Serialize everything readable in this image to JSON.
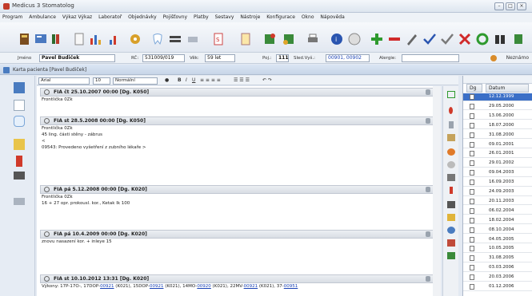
{
  "window": {
    "title": "Medicus 3 Stomatolog"
  },
  "menu": [
    "Program",
    "Ambulance",
    "Výkaz Výkaz",
    "Laboratoř",
    "Objednávky",
    "Pojišťovny",
    "Platby",
    "Sestavy",
    "Nástroje",
    "Konfigurace",
    "Okno",
    "Nápověda"
  ],
  "patient": {
    "name_label": "Jméno",
    "name": "Pavel Budiček",
    "rc_label": "RČ:",
    "rc": "531009/019",
    "age_label": "Věk:",
    "age": "59 let",
    "poj_label": "Poj.:",
    "poj": "111",
    "sled_label": "Sled.Vyš.:",
    "sled": "00901, 00902",
    "alergie_label": "Alergie:",
    "alergie": "",
    "unknown_label": "Neznámo"
  },
  "karta": {
    "title": "Karta pacienta [Pavel Budiček]"
  },
  "editor": {
    "font": "Arial",
    "size": "10",
    "style": "Normální"
  },
  "notes": [
    {
      "head": "FIA čt 25.10.2007 00:00 [Dg. K050]",
      "lines": [
        "Frontlička 0Zk"
      ]
    },
    {
      "head": "FIA st 28.5.2008 00:00 [Dg. K050]",
      "lines": [
        "Frontlička 0Zk",
        "45 ling. části stěny - zábrus",
        "<",
        "09543: Provedeno vyšetření z zubního lékaře >"
      ]
    },
    {
      "head": "FIA pá 5.12.2008 00:00 [Dg. K020]",
      "lines": [
        "Frontlička 0Zk",
        "16 + 27 opr. prokousl. kor., Ketak Ik 100"
      ]
    },
    {
      "head": "FIA pá 10.4.2009 00:00 [Dg. K020]",
      "lines": [
        "znovu nasazení kor. + inleye 15"
      ]
    },
    {
      "head": "FIA st 10.10.2012 13:31 [Dg. K020]",
      "lines": []
    }
  ],
  "last_line": {
    "pre": "Výkony: 17P-17O-, 17DOP-",
    "c1": "00921",
    "m1": " (K021), 15DOP-",
    "c2": "00921",
    "m2": " (K021), 14MO-",
    "c3": "00920",
    "m3": " (K021), 22MV-",
    "c4": "00921",
    "m4": " (K021), 37-",
    "c5": "00951"
  },
  "dates_table": {
    "col1": "Dg",
    "col2": "Datum",
    "rows": [
      "12.12.1999",
      "29.05.2000",
      "13.06.2000",
      "18.07.2000",
      "31.08.2000",
      "09.01.2001",
      "26.01.2001",
      "29.01.2002",
      "09.04.2003",
      "16.09.2003",
      "24.09.2003",
      "20.11.2003",
      "06.02.2004",
      "18.02.2004",
      "08.10.2004",
      "04.05.2005",
      "10.05.2005",
      "31.08.2005",
      "03.03.2006",
      "20.03.2006",
      "01.12.2006"
    ]
  }
}
